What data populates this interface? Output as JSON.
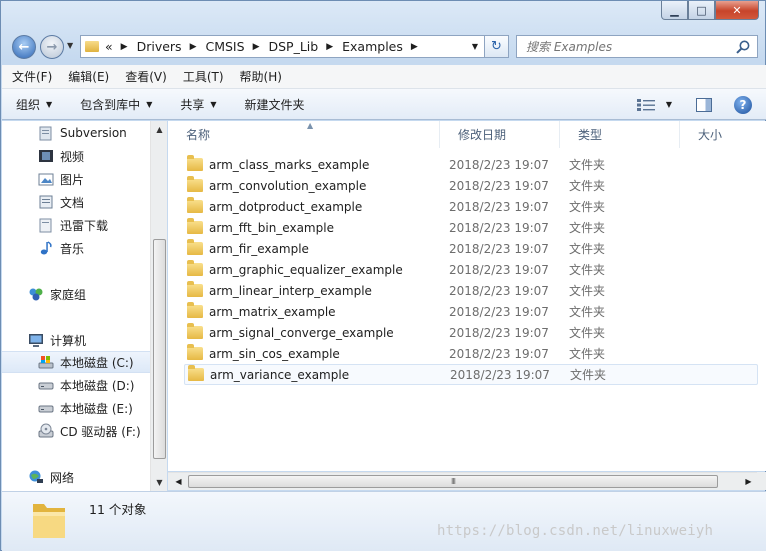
{
  "window": {
    "minimize_glyph": "▁",
    "maximize_glyph": "□",
    "close_glyph": "✕"
  },
  "address": {
    "overflow": "«",
    "crumbs": [
      "Drivers",
      "CMSIS",
      "DSP_Lib",
      "Examples"
    ],
    "search_placeholder": "搜索 Examples"
  },
  "menu": [
    "文件(F)",
    "编辑(E)",
    "查看(V)",
    "工具(T)",
    "帮助(H)"
  ],
  "toolbar": {
    "organize": "组织",
    "include_library": "包含到库中",
    "share": "共享",
    "new_folder": "新建文件夹"
  },
  "nav": {
    "items": [
      "Subversion",
      "视频",
      "图片",
      "文档",
      "迅雷下载",
      "音乐"
    ],
    "homegroup": "家庭组",
    "computer": "计算机",
    "drives": [
      "本地磁盘 (C:)",
      "本地磁盘 (D:)",
      "本地磁盘 (E:)",
      "CD 驱动器 (F:)"
    ],
    "network": "网络"
  },
  "columns": [
    "名称",
    "修改日期",
    "类型",
    "大小"
  ],
  "files": [
    {
      "name": "arm_class_marks_example",
      "date": "2018/2/23 19:07",
      "type": "文件夹"
    },
    {
      "name": "arm_convolution_example",
      "date": "2018/2/23 19:07",
      "type": "文件夹"
    },
    {
      "name": "arm_dotproduct_example",
      "date": "2018/2/23 19:07",
      "type": "文件夹"
    },
    {
      "name": "arm_fft_bin_example",
      "date": "2018/2/23 19:07",
      "type": "文件夹"
    },
    {
      "name": "arm_fir_example",
      "date": "2018/2/23 19:07",
      "type": "文件夹"
    },
    {
      "name": "arm_graphic_equalizer_example",
      "date": "2018/2/23 19:07",
      "type": "文件夹"
    },
    {
      "name": "arm_linear_interp_example",
      "date": "2018/2/23 19:07",
      "type": "文件夹"
    },
    {
      "name": "arm_matrix_example",
      "date": "2018/2/23 19:07",
      "type": "文件夹"
    },
    {
      "name": "arm_signal_converge_example",
      "date": "2018/2/23 19:07",
      "type": "文件夹"
    },
    {
      "name": "arm_sin_cos_example",
      "date": "2018/2/23 19:07",
      "type": "文件夹"
    },
    {
      "name": "arm_variance_example",
      "date": "2018/2/23 19:07",
      "type": "文件夹"
    }
  ],
  "details": {
    "count": "11 个对象"
  },
  "watermark": "https://blog.csdn.net/linuxweiyh"
}
